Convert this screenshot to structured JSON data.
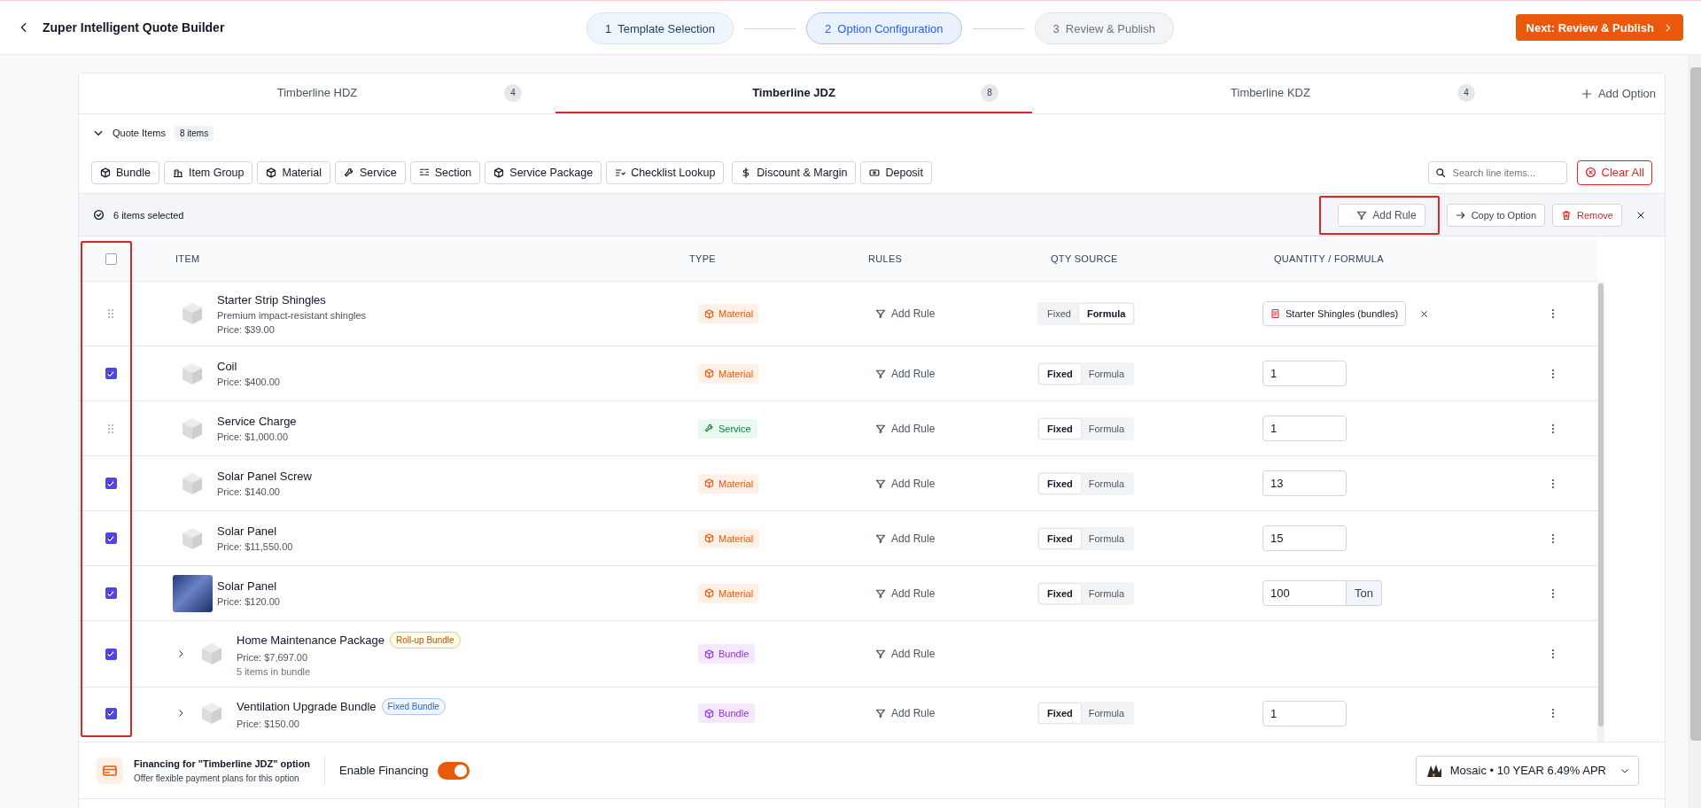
{
  "header": {
    "title": "Zuper Intelligent Quote Builder",
    "steps": [
      {
        "number": "1",
        "label": "Template Selection",
        "completed": true,
        "selected": false
      },
      {
        "number": "2",
        "label": "Option Configuration",
        "completed": false,
        "selected": true
      },
      {
        "number": "3",
        "label": "Review & Publish",
        "completed": false,
        "selected": false
      }
    ],
    "next_button": "Next: Review & Publish"
  },
  "option_tabs": [
    {
      "label": "Timberline HDZ",
      "count": "4",
      "selected": false
    },
    {
      "label": "Timberline JDZ",
      "count": "8",
      "selected": true
    },
    {
      "label": "Timberline KDZ",
      "count": "4",
      "selected": false
    }
  ],
  "add_option": "Add Option",
  "quote_items": {
    "label": "Quote Items",
    "count": "8 items",
    "expanded": true
  },
  "add_buttons": [
    {
      "label": "Bundle",
      "kind": "bundle"
    },
    {
      "label": "Item Group",
      "kind": "group"
    },
    {
      "label": "Material",
      "kind": "material"
    },
    {
      "label": "Service",
      "kind": "service"
    },
    {
      "label": "Section",
      "kind": "section"
    },
    {
      "label": "Service Package",
      "kind": "package"
    },
    {
      "label": "Checklist Lookup",
      "kind": "checklist"
    },
    {
      "label": "Discount & Margin",
      "kind": "discount"
    },
    {
      "label": "Deposit",
      "kind": "deposit"
    }
  ],
  "search": {
    "placeholder": "Search line items..."
  },
  "clear_all": "Clear All",
  "selection_bar": {
    "count": "6 items selected",
    "actions": [
      {
        "label": "Add Rule",
        "kind": "rule",
        "highlighted": true
      },
      {
        "label": "Copy to Option",
        "kind": "copy",
        "highlighted": false
      },
      {
        "label": "Remove",
        "kind": "remove",
        "highlighted": false
      }
    ]
  },
  "table": {
    "select_all": {
      "checked": false
    },
    "select_column_highlighted": true,
    "columns": [
      "ITEM",
      "TYPE",
      "RULES",
      "QTY SOURCE",
      "QUANTITY / FORMULA"
    ],
    "rows": [
      {
        "checked": false,
        "photo": false,
        "name": "Starter Strip Shingles",
        "description": "Premium impact-resistant shingles",
        "price": "Price: $39.00",
        "type": {
          "label": "Material",
          "kind": "material"
        },
        "rule": "Add Rule",
        "qty_options": [
          {
            "label": "Fixed",
            "selected": false
          },
          {
            "label": "Formula",
            "selected": true
          }
        ],
        "quantity": {
          "kind": "formula",
          "label": "Starter Shingles (bundles)"
        }
      },
      {
        "checked": true,
        "photo": false,
        "name": "Coil",
        "price": "Price: $400.00",
        "type": {
          "label": "Material",
          "kind": "material"
        },
        "rule": "Add Rule",
        "qty_options": [
          {
            "label": "Fixed",
            "selected": true
          },
          {
            "label": "Formula",
            "selected": false
          }
        ],
        "quantity": {
          "kind": "input",
          "value": "1"
        }
      },
      {
        "checked": false,
        "photo": false,
        "name": "Service Charge",
        "price": "Price: $1,000.00",
        "type": {
          "label": "Service",
          "kind": "service"
        },
        "rule": "Add Rule",
        "qty_options": [
          {
            "label": "Fixed",
            "selected": true
          },
          {
            "label": "Formula",
            "selected": false
          }
        ],
        "quantity": {
          "kind": "input",
          "value": "1"
        }
      },
      {
        "checked": true,
        "photo": false,
        "name": "Solar Panel Screw",
        "price": "Price: $140.00",
        "type": {
          "label": "Material",
          "kind": "material"
        },
        "rule": "Add Rule",
        "qty_options": [
          {
            "label": "Fixed",
            "selected": true
          },
          {
            "label": "Formula",
            "selected": false
          }
        ],
        "quantity": {
          "kind": "input",
          "value": "13"
        }
      },
      {
        "checked": true,
        "photo": false,
        "name": "Solar Panel",
        "price": "Price: $11,550.00",
        "type": {
          "label": "Material",
          "kind": "material"
        },
        "rule": "Add Rule",
        "qty_options": [
          {
            "label": "Fixed",
            "selected": true
          },
          {
            "label": "Formula",
            "selected": false
          }
        ],
        "quantity": {
          "kind": "input",
          "value": "15"
        }
      },
      {
        "checked": true,
        "photo": true,
        "name": "Solar Panel",
        "price": "Price: $120.00",
        "type": {
          "label": "Material",
          "kind": "material"
        },
        "rule": "Add Rule",
        "qty_options": [
          {
            "label": "Fixed",
            "selected": true
          },
          {
            "label": "Formula",
            "selected": false
          }
        ],
        "quantity": {
          "kind": "input",
          "value": "100",
          "unit": "Ton"
        }
      },
      {
        "checked": true,
        "photo": false,
        "expanded": false,
        "name": "Home Maintenance Package",
        "badge": {
          "label": "Roll-up Bundle",
          "kind": "rollup"
        },
        "price": "Price: $7,697.00",
        "bundle_count": "5 items in bundle",
        "type": {
          "label": "Bundle",
          "kind": "bundle"
        },
        "rule": "Add Rule"
      },
      {
        "checked": true,
        "photo": false,
        "expanded": false,
        "name": "Ventilation Upgrade Bundle",
        "badge": {
          "label": "Fixed Bundle",
          "kind": "fixed"
        },
        "price": "Price: $150.00",
        "type": {
          "label": "Bundle",
          "kind": "bundle"
        },
        "rule": "Add Rule",
        "qty_options": [
          {
            "label": "Fixed",
            "selected": true
          },
          {
            "label": "Formula",
            "selected": false
          }
        ],
        "quantity": {
          "kind": "input",
          "value": "1"
        }
      }
    ]
  },
  "financing": {
    "title": "Financing for \"Timberline JDZ\" option",
    "subtitle": "Offer flexible payment plans for this option",
    "toggle_label": "Enable Financing",
    "enabled": true,
    "provider": "Mosaic • 10 YEAR 6.49% APR"
  }
}
